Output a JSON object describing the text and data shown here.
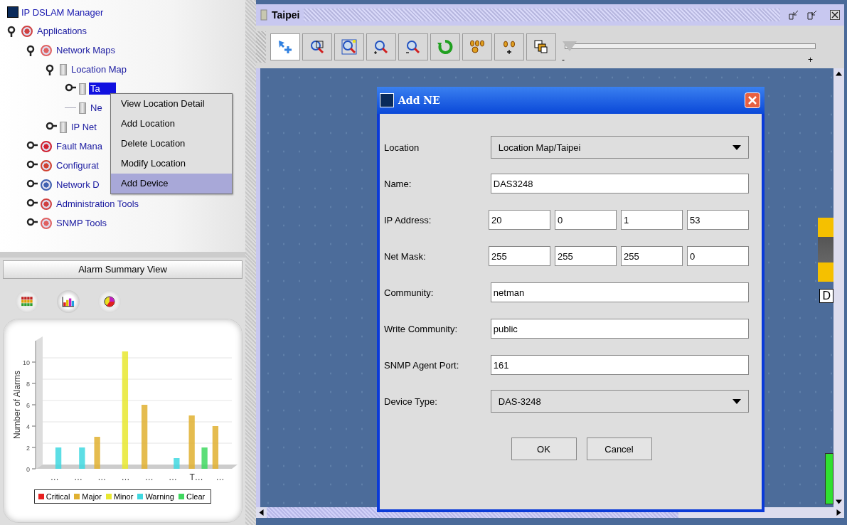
{
  "app": {
    "title": "IP DSLAM Manager"
  },
  "tree": [
    {
      "label": "Applications",
      "kind": "node",
      "expanded": true,
      "selected": false,
      "children": [
        {
          "label": "Network Maps",
          "kind": "node",
          "expanded": true,
          "selected": false,
          "children": [
            {
              "label": "Location Map",
              "kind": "node",
              "expanded": true,
              "selected": false,
              "children": [
                {
                  "label": "Ta",
                  "kind": "node",
                  "expanded": false,
                  "selected": true
                },
                {
                  "label": "Ne",
                  "kind": "leaf",
                  "selected": false
                }
              ]
            },
            {
              "label": "IP Net",
              "kind": "node",
              "expanded": false,
              "selected": false
            }
          ]
        },
        {
          "label": "Fault Mana",
          "kind": "node",
          "expanded": false,
          "selected": false
        },
        {
          "label": "Configurat",
          "kind": "node",
          "expanded": false,
          "selected": false
        },
        {
          "label": "Network D",
          "kind": "node",
          "expanded": false,
          "selected": false
        },
        {
          "label": "Administration Tools",
          "kind": "node",
          "expanded": false,
          "selected": false
        },
        {
          "label": "SNMP Tools",
          "kind": "node",
          "expanded": false,
          "selected": false
        }
      ]
    }
  ],
  "context_menu": [
    {
      "label": "View Location Detail",
      "selected": false
    },
    {
      "label": "Add Location",
      "selected": false
    },
    {
      "label": "Delete Location",
      "selected": false
    },
    {
      "label": "Modify Location",
      "selected": false
    },
    {
      "label": "Add Device",
      "selected": true
    }
  ],
  "alarm_panel": {
    "title": "Alarm Summary View",
    "views": [
      {
        "kind": "table",
        "selected": false
      },
      {
        "kind": "bar",
        "selected": true
      },
      {
        "kind": "pie",
        "selected": false
      }
    ],
    "chart_data": {
      "type": "bar",
      "ylabel": "Number of Alarms",
      "categories": [
        "…",
        "…",
        "…",
        "…",
        "…",
        "…",
        "T…",
        "…"
      ],
      "series": [
        {
          "name": "Critical",
          "color": "#e82020",
          "values": [
            0,
            0,
            0,
            0,
            0,
            0,
            0,
            0
          ]
        },
        {
          "name": "Major",
          "color": "#e0b030",
          "values": [
            0,
            0,
            3,
            0,
            6,
            0,
            5,
            4
          ]
        },
        {
          "name": "Minor",
          "color": "#e8e830",
          "values": [
            0,
            0,
            0,
            11,
            0,
            0,
            0,
            0
          ]
        },
        {
          "name": "Warning",
          "color": "#40d8e0",
          "values": [
            2,
            2,
            0,
            0,
            0,
            1,
            0,
            0
          ]
        },
        {
          "name": "Clear",
          "color": "#40d860",
          "values": [
            0,
            0,
            0,
            0,
            0,
            0,
            2,
            0
          ]
        }
      ],
      "ylim": [
        0,
        12
      ],
      "yticks": [
        0,
        2,
        4,
        6,
        8,
        10
      ]
    }
  },
  "map_window": {
    "title": "Taipei",
    "device_label": "D",
    "toolbar": [
      {
        "kind": "select",
        "selected": true
      },
      {
        "kind": "zoom-region",
        "selected": false
      },
      {
        "kind": "zoom-fit",
        "selected": false
      },
      {
        "kind": "zoom-in",
        "selected": false
      },
      {
        "kind": "zoom-out",
        "selected": false
      },
      {
        "kind": "refresh",
        "selected": false
      },
      {
        "kind": "group",
        "selected": false
      },
      {
        "kind": "add",
        "selected": false
      },
      {
        "kind": "layers",
        "selected": false
      }
    ],
    "zoom_slider": {
      "level": 0.02,
      "min_label": "-",
      "max_label": "+"
    }
  },
  "dialog": {
    "title": "Add NE",
    "fields": [
      {
        "label": "Location",
        "kind": "dropdown",
        "value": "Location Map/Taipei"
      },
      {
        "label": "Name:",
        "kind": "text",
        "value": "DAS3248"
      },
      {
        "label": "IP Address:",
        "kind": "octets",
        "values": [
          "20",
          "0",
          "1",
          "53"
        ]
      },
      {
        "label": "Net Mask:",
        "kind": "octets",
        "values": [
          "255",
          "255",
          "255",
          "0"
        ]
      },
      {
        "label": "Community:",
        "kind": "text",
        "value": "netman"
      },
      {
        "label": "Write Community:",
        "kind": "text",
        "value": "public"
      },
      {
        "label": "SNMP Agent Port:",
        "kind": "text",
        "value": "161"
      },
      {
        "label": "Device Type:",
        "kind": "dropdown",
        "value": "DAS-3248"
      }
    ],
    "buttons": [
      "OK",
      "Cancel"
    ]
  }
}
